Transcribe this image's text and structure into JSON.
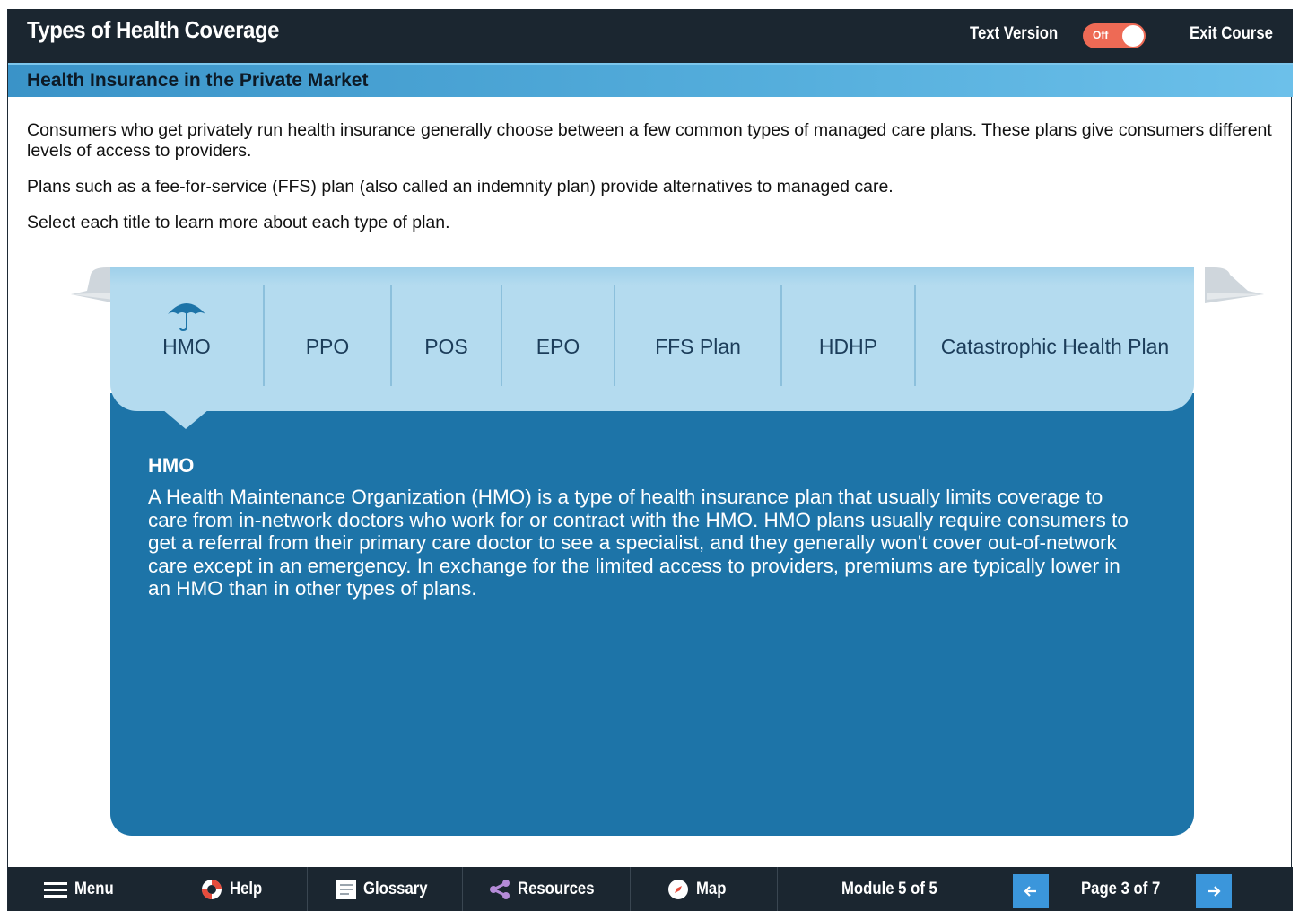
{
  "header": {
    "title": "Types of Health Coverage",
    "text_version_label": "Text Version",
    "toggle_state": "Off",
    "exit_label": "Exit Course"
  },
  "section": {
    "title": "Health Insurance in the Private Market"
  },
  "intro": {
    "paragraph1": "Consumers who get privately run health insurance generally choose between a few common types of managed care plans. These plans give consumers different levels of access to providers.",
    "paragraph2": "Plans such as a fee-for-service (FFS) plan (also called an indemnity plan) provide alternatives to managed care.",
    "paragraph3": "Select each title to learn more about each type of plan."
  },
  "tabs": [
    {
      "label": "HMO",
      "icon": "umbrella-icon",
      "selected": true
    },
    {
      "label": "PPO"
    },
    {
      "label": "POS"
    },
    {
      "label": "EPO"
    },
    {
      "label": "FFS Plan"
    },
    {
      "label": "HDHP"
    },
    {
      "label": "Catastrophic Health Plan"
    }
  ],
  "content": {
    "heading": "HMO",
    "body": "A Health Maintenance Organization (HMO) is a type of health insurance plan that usually limits coverage to care from in-network doctors who work for or contract with the HMO. HMO plans usually require consumers to get a referral from their primary care doctor to see a specialist, and they generally won't cover out-of-network care except in an emergency. In exchange for the limited access to providers, premiums are typically lower in an HMO than in other types of plans."
  },
  "footer": {
    "menu_label": "Menu",
    "help_label": "Help",
    "glossary_label": "Glossary",
    "resources_label": "Resources",
    "map_label": "Map",
    "module_label": "Module 5 of 5",
    "page_label": "Page 3 of 7",
    "prev_icon": "arrow-left-icon",
    "next_icon": "arrow-right-icon"
  },
  "colors": {
    "dark_bar": "#1b2630",
    "section_blue": "#4aa4d6",
    "tab_light": "#b4dbef",
    "content_blue": "#1d74a8",
    "toggle_off": "#ee6a55",
    "nav_button": "#3b96db"
  }
}
